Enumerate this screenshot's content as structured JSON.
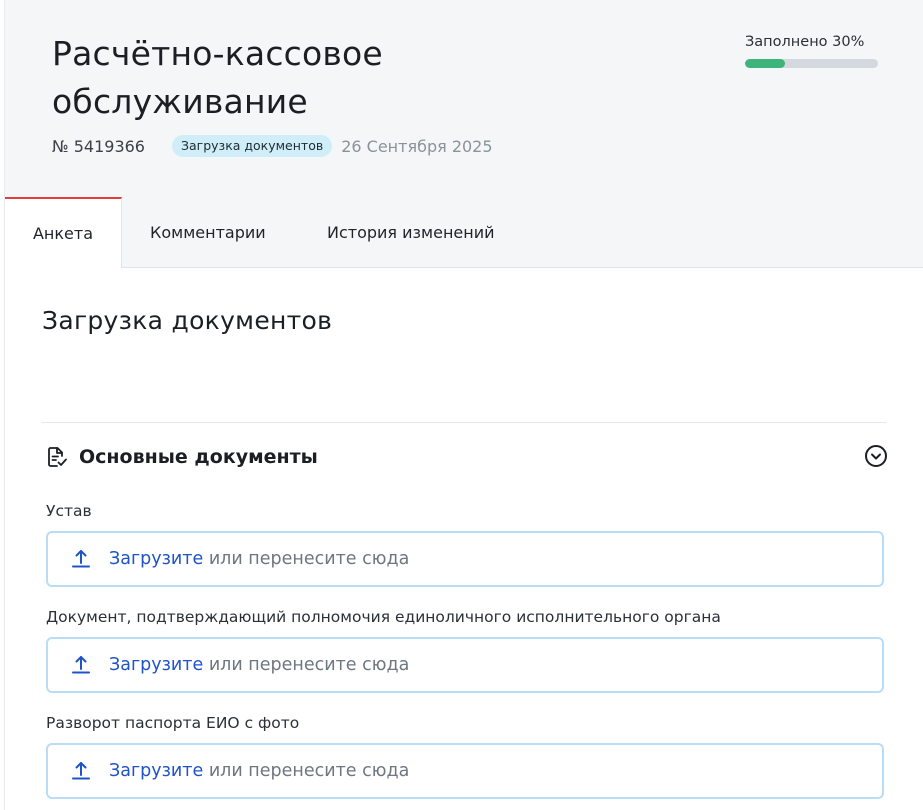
{
  "header": {
    "title_line1": "Расчётно-кассовое",
    "title_line2": "обслуживание",
    "number": "№ 5419366",
    "status": "Загрузка документов",
    "date": "26 Сентября 2025",
    "progress_label": "Заполнено 30%",
    "progress_fraction": 0.3
  },
  "tabs": [
    {
      "label": "Анкета",
      "active": true
    },
    {
      "label": "Комментарии",
      "active": false
    },
    {
      "label": "История изменений",
      "active": false
    }
  ],
  "section": {
    "title": "Загрузка документов",
    "group_title": "Основные документы",
    "group_icon": "document-check-icon",
    "collapse_icon": "chevron-down-circle-icon"
  },
  "fields": [
    {
      "label": "Устав",
      "link": "Загрузите",
      "rest": " или перенесите сюда"
    },
    {
      "label": "Документ, подтверждающий полномочия единоличного исполнительного органа",
      "link": "Загрузите",
      "rest": " или перенесите сюда"
    },
    {
      "label": "Разворот паспорта ЕИО с фото",
      "link": "Загрузите",
      "rest": " или перенесите сюда"
    }
  ],
  "colors": {
    "accent_tab": "#e1403a",
    "progress": "#3db57a",
    "link": "#1f53c8",
    "dropzone_border": "#b9ddf5"
  }
}
